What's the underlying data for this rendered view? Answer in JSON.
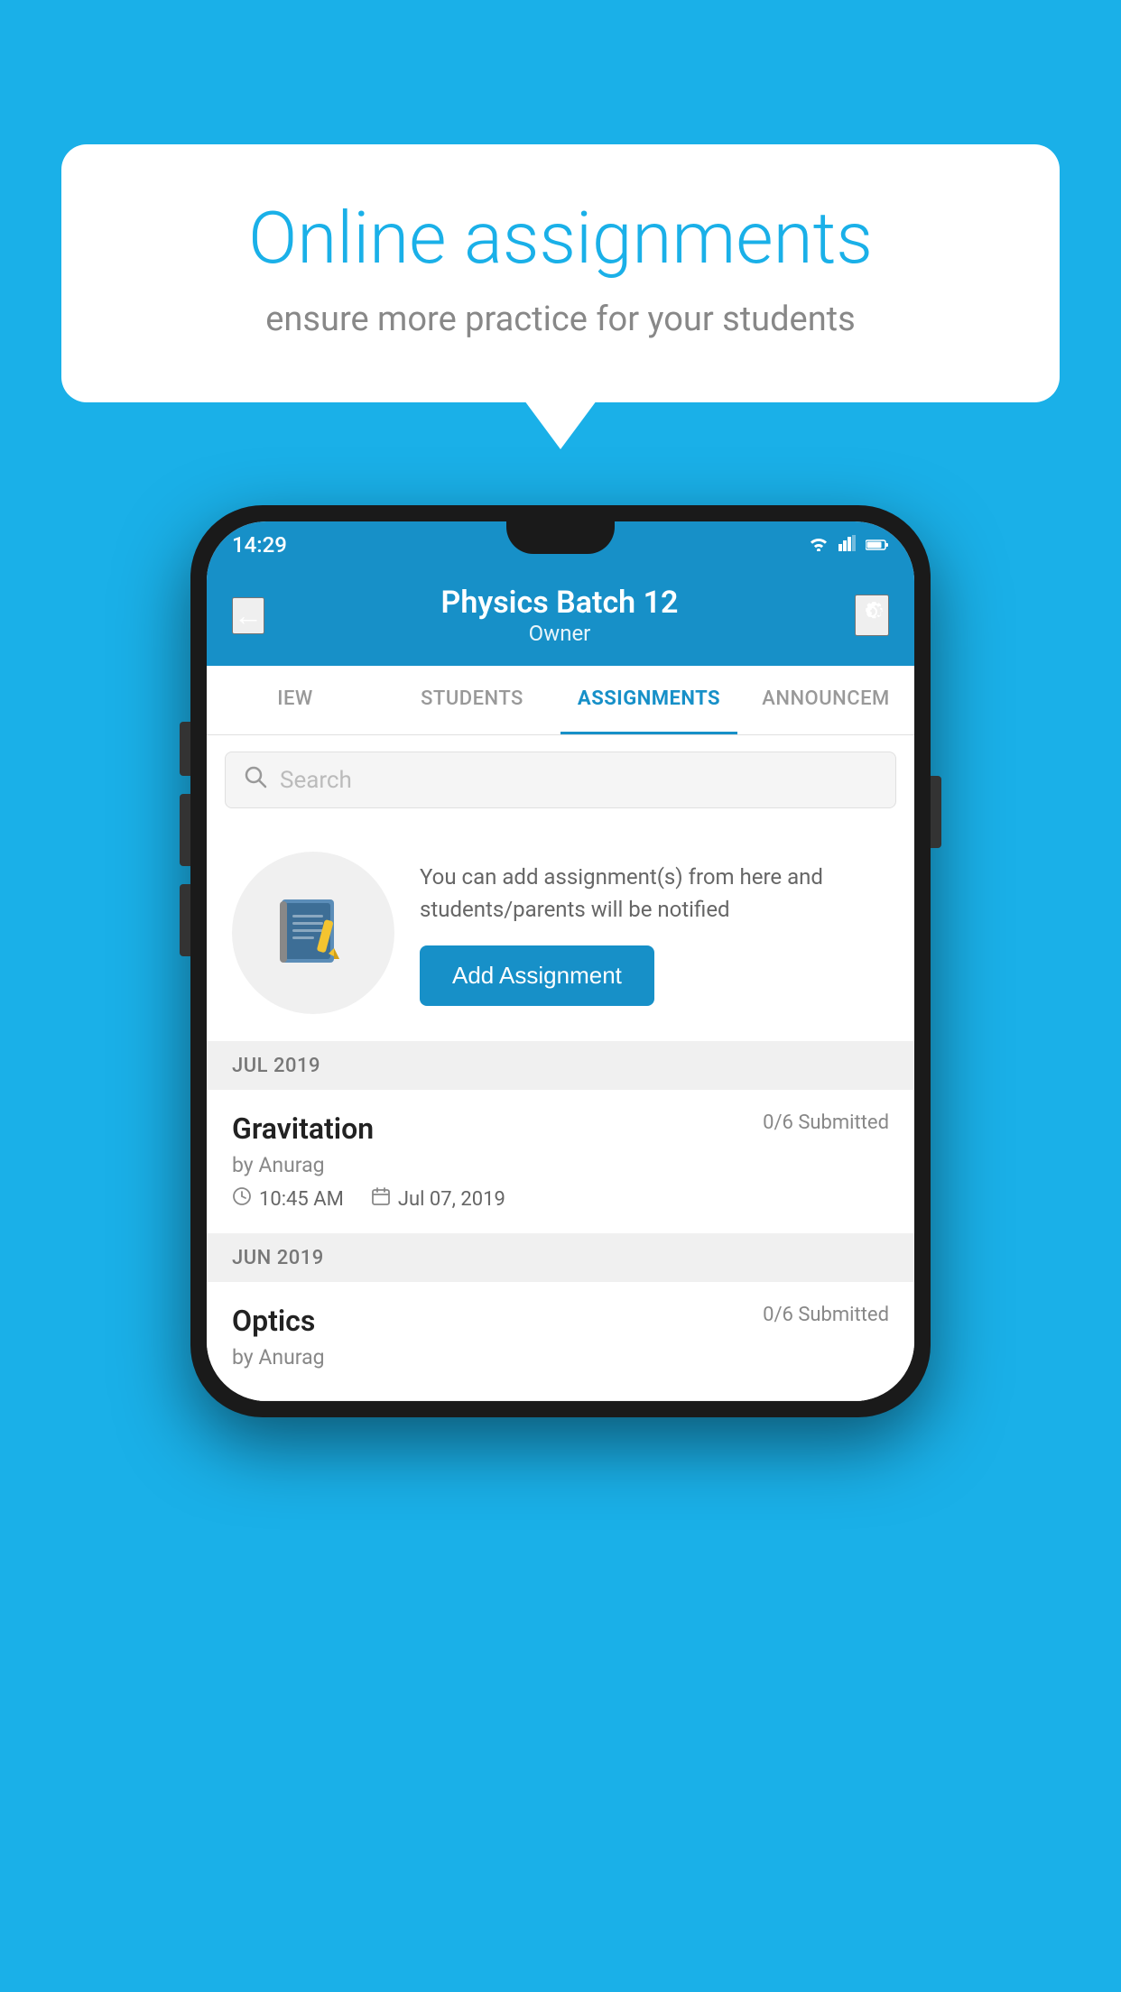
{
  "background": {
    "color": "#1ab0e8"
  },
  "speech_bubble": {
    "title": "Online assignments",
    "subtitle": "ensure more practice for your students"
  },
  "phone": {
    "status_bar": {
      "time": "14:29",
      "wifi_icon": "▾",
      "signal_icon": "▲",
      "battery_icon": "▮"
    },
    "header": {
      "title": "Physics Batch 12",
      "subtitle": "Owner",
      "back_label": "←",
      "settings_label": "⚙"
    },
    "tabs": [
      {
        "label": "IEW",
        "active": false
      },
      {
        "label": "STUDENTS",
        "active": false
      },
      {
        "label": "ASSIGNMENTS",
        "active": true
      },
      {
        "label": "ANNOUNCEM",
        "active": false
      }
    ],
    "search": {
      "placeholder": "Search"
    },
    "promo": {
      "text": "You can add assignment(s) from here and students/parents will be notified",
      "button_label": "Add Assignment"
    },
    "assignments": {
      "sections": [
        {
          "month_label": "JUL 2019",
          "items": [
            {
              "name": "Gravitation",
              "submitted": "0/6 Submitted",
              "author": "by Anurag",
              "time": "10:45 AM",
              "date": "Jul 07, 2019"
            }
          ]
        },
        {
          "month_label": "JUN 2019",
          "items": [
            {
              "name": "Optics",
              "submitted": "0/6 Submitted",
              "author": "by Anurag",
              "time": "",
              "date": ""
            }
          ]
        }
      ]
    }
  }
}
